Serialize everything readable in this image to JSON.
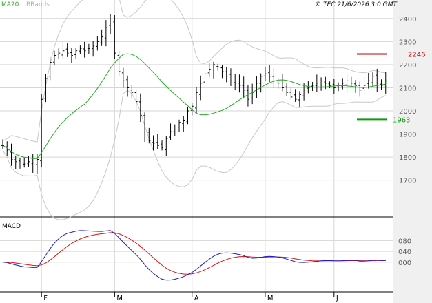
{
  "copyright": "© TEC 21/6/2026 3:0 GMT",
  "legend": {
    "ma": "MA20",
    "bb": "BBands"
  },
  "macd_label": "MACD",
  "colors": {
    "price": "#000000",
    "ma": "#22aa22",
    "bbands": "#c8c8c8",
    "grid": "#d6d6d6",
    "macd": "#1a1acc",
    "signal": "#dd1111",
    "resistance": "#cc0000",
    "support": "#119911",
    "sidebar": "#f0f0f0"
  },
  "chart_data": [
    {
      "type": "ohlc",
      "y_ticks": [
        1700,
        1800,
        1900,
        2000,
        2100,
        2200,
        2300,
        2400
      ],
      "ylim": [
        1550,
        2450
      ],
      "x_labels": [
        "F",
        "M",
        "A",
        "M",
        "J"
      ],
      "x_label_index": [
        9,
        26,
        44,
        61,
        77
      ],
      "grid": true,
      "legend_position": "top-left",
      "n_bars": 90,
      "closes": [
        1850,
        1830,
        1790,
        1780,
        1775,
        1770,
        1780,
        1775,
        1790,
        2050,
        2140,
        2210,
        2240,
        2250,
        2260,
        2250,
        2240,
        2260,
        2270,
        2260,
        2270,
        2280,
        2300,
        2320,
        2360,
        2380,
        2250,
        2170,
        2130,
        2100,
        2080,
        2040,
        1980,
        1900,
        1870,
        1860,
        1850,
        1840,
        1880,
        1910,
        1930,
        1950,
        1960,
        2000,
        2020,
        2080,
        2120,
        2160,
        2180,
        2200,
        2190,
        2170,
        2150,
        2130,
        2120,
        2110,
        2090,
        2050,
        2080,
        2120,
        2150,
        2160,
        2150,
        2130,
        2120,
        2100,
        2080,
        2060,
        2050,
        2070,
        2090,
        2100,
        2110,
        2120,
        2130,
        2120,
        2110,
        2100,
        2110,
        2120,
        2130,
        2120,
        2110,
        2090,
        2110,
        2130,
        2150,
        2120,
        2110,
        2130
      ],
      "resistance": {
        "value": 2246,
        "label": "2246"
      },
      "support": {
        "value": 1963,
        "label": "1963"
      }
    },
    {
      "type": "line",
      "name": "MACD",
      "y_ticks": [
        "000",
        "040",
        "080"
      ],
      "y_tick_values": [
        0,
        40,
        80
      ],
      "ylim": [
        -100,
        160
      ]
    }
  ]
}
